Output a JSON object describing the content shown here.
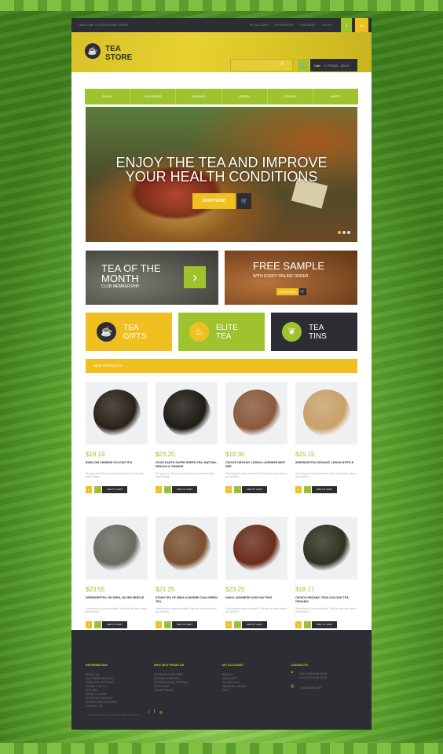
{
  "topbar": {
    "welcome": "WELCOME TO OUR ONLINE STORE!",
    "links": [
      "MY ACCOUNT",
      "MY WISHLIST",
      "CHECKOUT",
      "LOG IN"
    ],
    "currency": "$",
    "language": "En"
  },
  "header": {
    "logo_line1": "TEA",
    "logo_line2": "STORE",
    "cart_label": "Cart",
    "cart_info": "0 ITEM(S) - $0.00"
  },
  "nav": [
    "BLACK",
    "FLAVOURED",
    "ORGANIC",
    "GREEN",
    "OOLONG",
    "WHITE"
  ],
  "hero": {
    "line1": "ENJOY THE TEA AND IMPROVE",
    "line2": "YOUR HEALTH CONDITIONS",
    "button": "SHOP NOW!"
  },
  "banners": [
    {
      "title1": "TEA OF THE",
      "title2": "MONTH",
      "sub": "CLUB MEMBERSHIP"
    },
    {
      "title": "FREE SAMPLE",
      "sub": "WITH EVERY ONLINE ORDER",
      "button": "SHOP NOW"
    }
  ],
  "categories": [
    {
      "line1": "TEA",
      "line2": "GIFTS",
      "icon": "teacup-icon"
    },
    {
      "line1": "ELITE",
      "line2": "TEA",
      "icon": "teapot-icon"
    },
    {
      "line1": "TEA",
      "line2": "TINS",
      "icon": "leaf-icon"
    }
  ],
  "new_products_label": "NEW PRODUCTS",
  "products": [
    {
      "price": "$19.19",
      "name": "BIGELOW CHINESE OOLONG TEA",
      "desc": "Our goal is to fill your cup with tea you can drink with great delight.",
      "qty": "1",
      "add": "ADD TO CART",
      "color": "#2a2218"
    },
    {
      "price": "$23.20",
      "name": "GOOD EARTH SUPER GREEN TEA, MATCHA, SENCHA & ORANGE",
      "desc": "Our goal is to fill your cup with tea you can drink with great delight.",
      "qty": "1",
      "add": "ADD TO CART",
      "color": "#1e1a14"
    },
    {
      "price": "$18.30",
      "name": "CHOICE ORGANIC LEMON LAVENDER MINT HER",
      "desc": "Searching for a good ashwell? Visit our flat store where you will find.",
      "qty": "1",
      "add": "ADD TO CART",
      "color": "#8a5a3c"
    },
    {
      "price": "$25.15",
      "name": "SERENDIPITEA ORGANIC LEMON MYRTLE",
      "desc": "Searching for a good ashwell? Visit our flat store where you will find.",
      "qty": "1",
      "add": "ADD TO CART",
      "color": "#c9a16a"
    },
    {
      "price": "$23.55",
      "name": "SERENDIPITEA YIN ZHEN, SILVER NEEDLE",
      "desc": "Searching for a good ashwell? Visit our flat store where you will find.",
      "qty": "1",
      "add": "ADD TO CART",
      "color": "#6b6a60"
    },
    {
      "price": "$21.25",
      "name": "STASH TEA OF INDIA KASHMIRI CHAI GREEN TEA",
      "desc": "Searching for a good ashwell? Visit our flat store where you will find.",
      "qty": "1",
      "add": "ADD TO CART",
      "color": "#7a5030"
    },
    {
      "price": "$23.25",
      "name": "HAIKU JAPANESE KUKICHA TWIG",
      "desc": "Searching for a good ashwell? Visit our flat store where you will find.",
      "qty": "1",
      "add": "ADD TO CART",
      "color": "#6a2e1c"
    },
    {
      "price": "$18.17",
      "name": "CHOICE ORGANIC TEAS OOLONG TEA ORGANIC",
      "desc": "Searching for a good ashwell? Visit our flat store where you will find.",
      "qty": "1",
      "add": "ADD TO CART",
      "color": "#2e3220"
    }
  ],
  "footer": {
    "columns": [
      {
        "title": "INFORMATION",
        "links": [
          "ABOUT US",
          "CUSTOMER SERVICE",
          "TEMPLATE SETTINGS",
          "PRIVACY POLICY",
          "SITE MAP",
          "SEARCH TERMS",
          "ADVANCED SEARCH",
          "ORDERS AND RETURNS",
          "CONTACT US"
        ]
      },
      {
        "title": "WHY BUY FROM US",
        "links": [
          "SHIPPING & RETURNS",
          "SECURE SHOPPING",
          "INTERNATIONAL SHIPPING",
          "AFFILIATES",
          "GROUP SALES"
        ]
      },
      {
        "title": "MY ACCOUNT",
        "links": [
          "SIGN IN",
          "VIEW CART",
          "MY WISHLIST",
          "TRACK MY ORDER",
          "HELP"
        ]
      },
      {
        "title": "CONTACTS",
        "links": []
      }
    ],
    "address_line1": "5601 FRANKLIN ROAD,",
    "address_line2": "GLASGOW, D04 89GR",
    "phone": "+1(800)2345-6789",
    "copyright": "© 2015 Magento Demo Store. All Rights Reserved."
  },
  "colors": {
    "yellow": "#f0c020",
    "green": "#9fc32f",
    "dark": "#2c2e33"
  }
}
